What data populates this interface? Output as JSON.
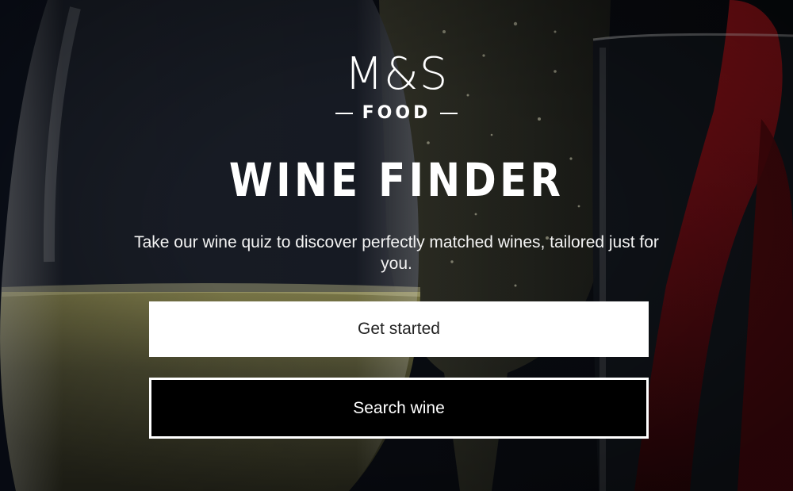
{
  "brand": {
    "logo_main": "M&S",
    "logo_sub": "FOOD"
  },
  "hero": {
    "title": "WINE FINDER",
    "description": "Take our wine quiz to discover perfectly matched wines, tailored just for you."
  },
  "actions": {
    "primary_label": "Get started",
    "secondary_label": "Search wine"
  },
  "colors": {
    "background": "#0b0e14",
    "primary_button_bg": "#ffffff",
    "primary_button_text": "#222222",
    "secondary_button_bg": "#000000",
    "secondary_button_border": "#ffffff",
    "white_wine": "#b8b36a",
    "red_wine": "#7a0f14"
  },
  "background_image": {
    "subject": "wine glasses with white wine, sparkling wine and red wine being poured"
  }
}
